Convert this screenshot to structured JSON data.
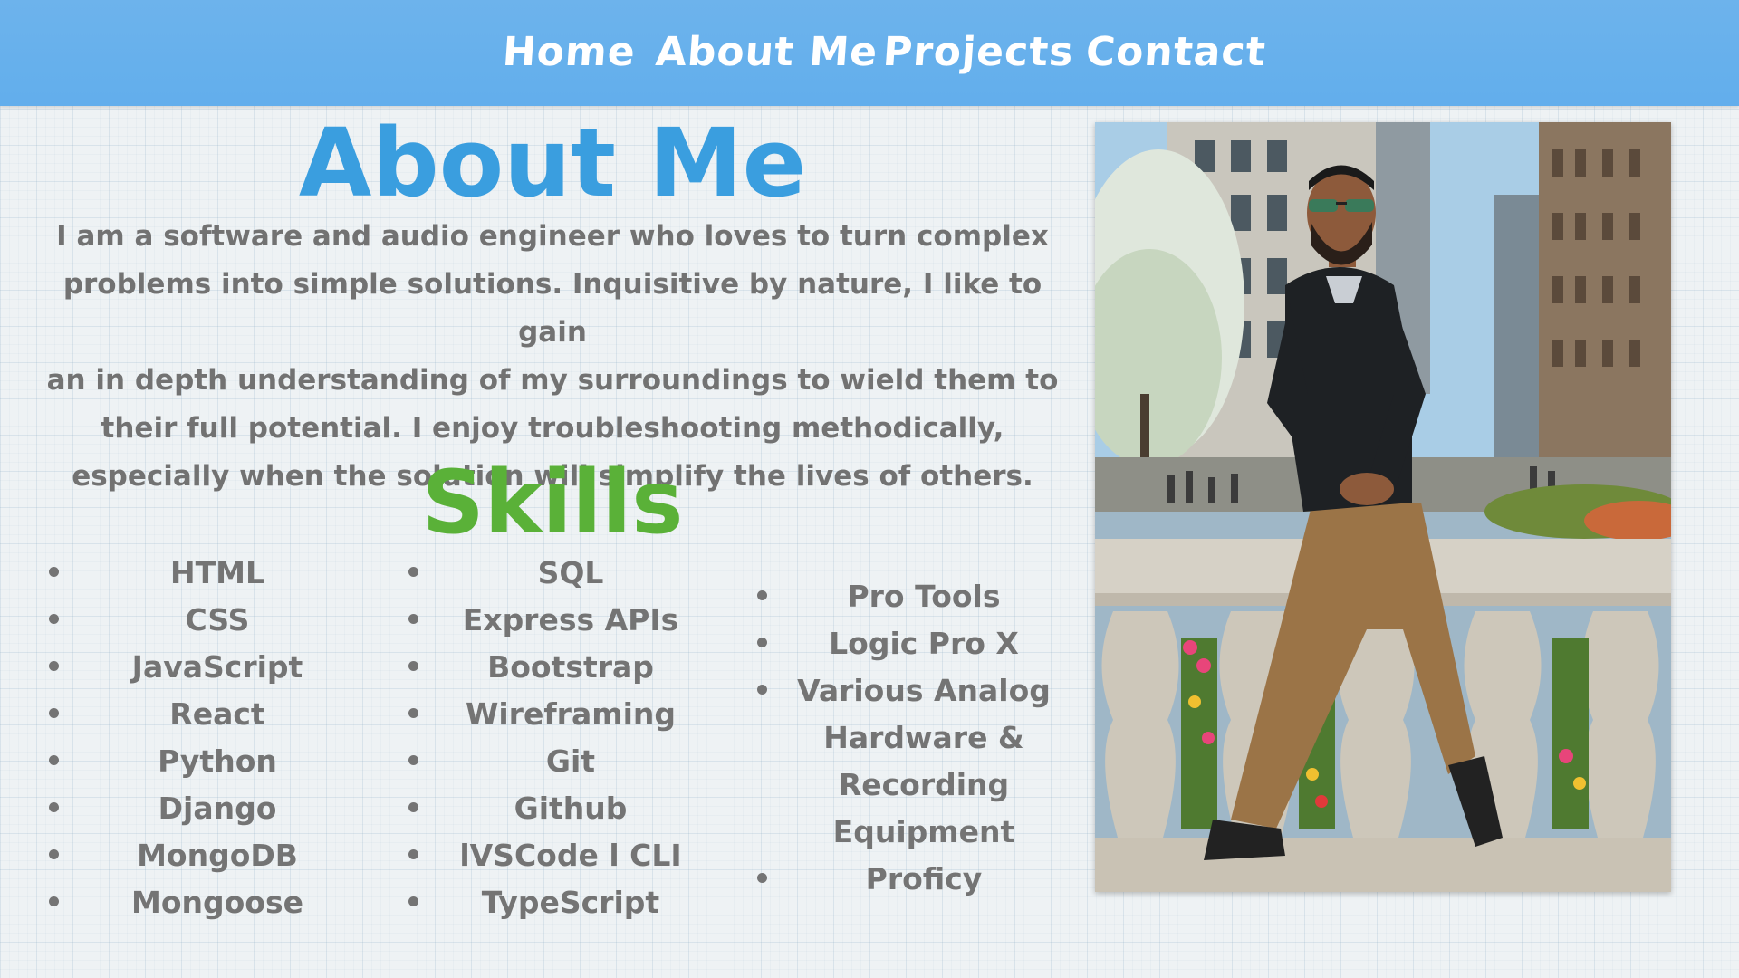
{
  "nav": {
    "items": [
      "Home",
      "About Me",
      "Projects",
      "Contact"
    ],
    "color": "#ffffff",
    "background": "#66b0ec"
  },
  "about": {
    "heading": "About Me",
    "heading_color": "#3a9edf",
    "bio_lines": [
      "I am a software and audio engineer who loves to turn complex",
      "problems into simple solutions. Inquisitive by nature, I like to gain",
      "an in depth understanding of my surroundings to wield them to",
      "their full potential. I enjoy troubleshooting methodically,",
      "especially when the solution will simplify the lives of others."
    ]
  },
  "skills": {
    "heading": "Skills",
    "heading_color": "#5ab138",
    "column1": [
      "HTML",
      "CSS",
      "JavaScript",
      "React",
      "Python",
      "Django",
      "MongoDB",
      "Mongoose"
    ],
    "column2": [
      "SQL",
      "Express APIs",
      "Bootstrap",
      "Wireframing",
      "Git",
      "Github",
      "lVSCode l CLI",
      "TypeScript"
    ],
    "column3": [
      "Pro Tools",
      "Logic Pro X",
      "Various Analog\nHardware &\nRecording\nEquipment",
      "Proficy"
    ]
  },
  "photo": {
    "subject": "man-sitting-on-stone-balustrade-city-street"
  }
}
